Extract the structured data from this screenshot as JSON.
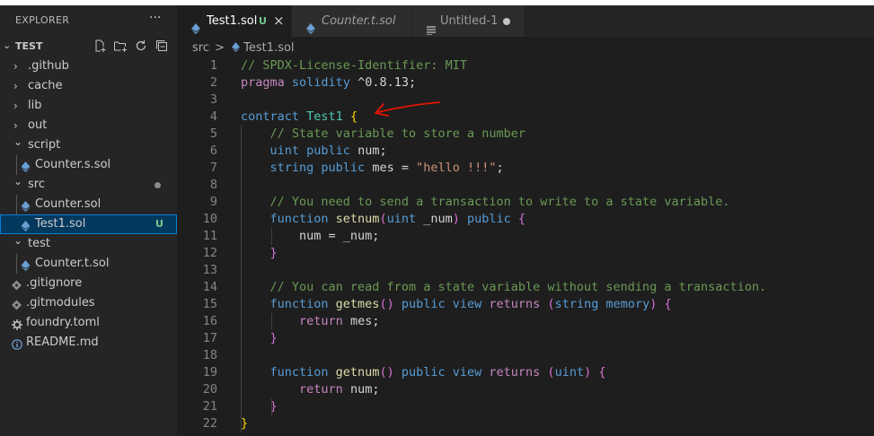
{
  "explorer": {
    "title": "EXPLORER",
    "more": "···",
    "root": "TEST",
    "items": [
      {
        "label": ".github",
        "type": "folder",
        "depth": 0,
        "open": false
      },
      {
        "label": "cache",
        "type": "folder",
        "depth": 0,
        "open": false
      },
      {
        "label": "lib",
        "type": "folder",
        "depth": 0,
        "open": false
      },
      {
        "label": "out",
        "type": "folder",
        "depth": 0,
        "open": false
      },
      {
        "label": "script",
        "type": "folder",
        "depth": 0,
        "open": true
      },
      {
        "label": "Counter.s.sol",
        "type": "sol",
        "depth": 1
      },
      {
        "label": "src",
        "type": "folder",
        "depth": 0,
        "open": true,
        "dot": true
      },
      {
        "label": "Counter.sol",
        "type": "sol",
        "depth": 1
      },
      {
        "label": "Test1.sol",
        "type": "sol",
        "depth": 1,
        "selected": true,
        "badge": "U"
      },
      {
        "label": "test",
        "type": "folder",
        "depth": 0,
        "open": true
      },
      {
        "label": "Counter.t.sol",
        "type": "sol",
        "depth": 1
      },
      {
        "label": ".gitignore",
        "type": "git",
        "depth": 0
      },
      {
        "label": ".gitmodules",
        "type": "git",
        "depth": 0
      },
      {
        "label": "foundry.toml",
        "type": "gear",
        "depth": 0
      },
      {
        "label": "README.md",
        "type": "info",
        "depth": 0
      }
    ]
  },
  "tabs": [
    {
      "label": "Test1.sol",
      "status": "U",
      "close": "×",
      "active": true
    },
    {
      "label": "Counter.t.sol",
      "active": false,
      "italic": true
    },
    {
      "label": "Untitled-1",
      "active": false,
      "dirty": true
    }
  ],
  "breadcrumb": {
    "folder": "src",
    "sep": ">",
    "file": "Test1.sol"
  },
  "code_lines": [
    {
      "n": "1",
      "tokens": [
        [
          "c-comment",
          "// SPDX-License-Identifier: MIT"
        ]
      ]
    },
    {
      "n": "2",
      "tokens": [
        [
          "c-kw2",
          "pragma "
        ],
        [
          "c-kw",
          "solidity "
        ],
        [
          "c-ver",
          "^0.8.13;"
        ]
      ]
    },
    {
      "n": "3",
      "tokens": []
    },
    {
      "n": "4",
      "tokens": [
        [
          "c-kw",
          "contract "
        ],
        [
          "c-type",
          "Test1 "
        ],
        [
          "c-brace",
          "{"
        ]
      ]
    },
    {
      "n": "5",
      "tokens": [
        [
          "c-plain",
          "    "
        ],
        [
          "c-comment",
          "// State variable to store a number"
        ]
      ]
    },
    {
      "n": "6",
      "tokens": [
        [
          "c-plain",
          "    "
        ],
        [
          "c-kw",
          "uint "
        ],
        [
          "c-kw",
          "public "
        ],
        [
          "c-plain",
          "num;"
        ]
      ]
    },
    {
      "n": "7",
      "tokens": [
        [
          "c-plain",
          "    "
        ],
        [
          "c-kw",
          "string "
        ],
        [
          "c-kw",
          "public "
        ],
        [
          "c-plain",
          "mes = "
        ],
        [
          "c-str",
          "\"hello !!!\""
        ],
        [
          "c-plain",
          ";"
        ]
      ]
    },
    {
      "n": "8",
      "tokens": []
    },
    {
      "n": "9",
      "tokens": [
        [
          "c-plain",
          "    "
        ],
        [
          "c-comment",
          "// You need to send a transaction to write to a state variable."
        ]
      ]
    },
    {
      "n": "10",
      "tokens": [
        [
          "c-plain",
          "    "
        ],
        [
          "c-kw",
          "function "
        ],
        [
          "c-fn",
          "setnum"
        ],
        [
          "c-brace2",
          "("
        ],
        [
          "c-kw",
          "uint "
        ],
        [
          "c-plain",
          "_num"
        ],
        [
          "c-brace2",
          ")"
        ],
        [
          "c-kw",
          " public "
        ],
        [
          "c-brace2",
          "{"
        ]
      ]
    },
    {
      "n": "11",
      "tokens": [
        [
          "c-plain",
          "        num = _num;"
        ]
      ]
    },
    {
      "n": "12",
      "tokens": [
        [
          "c-plain",
          "    "
        ],
        [
          "c-brace2",
          "}"
        ]
      ]
    },
    {
      "n": "13",
      "tokens": []
    },
    {
      "n": "14",
      "tokens": [
        [
          "c-plain",
          "    "
        ],
        [
          "c-comment",
          "// You can read from a state variable without sending a transaction."
        ]
      ]
    },
    {
      "n": "15",
      "tokens": [
        [
          "c-plain",
          "    "
        ],
        [
          "c-kw",
          "function "
        ],
        [
          "c-fn",
          "getmes"
        ],
        [
          "c-brace2",
          "()"
        ],
        [
          "c-kw",
          " public view "
        ],
        [
          "c-kw2",
          "returns "
        ],
        [
          "c-brace2",
          "("
        ],
        [
          "c-kw",
          "string memory"
        ],
        [
          "c-brace2",
          ")"
        ],
        [
          "c-plain",
          " "
        ],
        [
          "c-brace2",
          "{"
        ]
      ]
    },
    {
      "n": "16",
      "tokens": [
        [
          "c-plain",
          "        "
        ],
        [
          "c-kw2",
          "return "
        ],
        [
          "c-plain",
          "mes;"
        ]
      ]
    },
    {
      "n": "17",
      "tokens": [
        [
          "c-plain",
          "    "
        ],
        [
          "c-brace2",
          "}"
        ]
      ]
    },
    {
      "n": "18",
      "tokens": []
    },
    {
      "n": "19",
      "tokens": [
        [
          "c-plain",
          "    "
        ],
        [
          "c-kw",
          "function "
        ],
        [
          "c-fn",
          "getnum"
        ],
        [
          "c-brace2",
          "()"
        ],
        [
          "c-kw",
          " public view "
        ],
        [
          "c-kw2",
          "returns "
        ],
        [
          "c-brace2",
          "("
        ],
        [
          "c-kw",
          "uint"
        ],
        [
          "c-brace2",
          ")"
        ],
        [
          "c-plain",
          " "
        ],
        [
          "c-brace2",
          "{"
        ]
      ]
    },
    {
      "n": "20",
      "tokens": [
        [
          "c-plain",
          "        "
        ],
        [
          "c-kw2",
          "return "
        ],
        [
          "c-plain",
          "num;"
        ]
      ]
    },
    {
      "n": "21",
      "tokens": [
        [
          "c-plain",
          "    "
        ],
        [
          "c-brace2",
          "}"
        ]
      ]
    },
    {
      "n": "22",
      "tokens": [
        [
          "c-brace",
          "}"
        ]
      ]
    }
  ],
  "colors": {
    "accent": "#007fd4",
    "untracked": "#73c991",
    "annotation_arrow": "#e51400"
  }
}
